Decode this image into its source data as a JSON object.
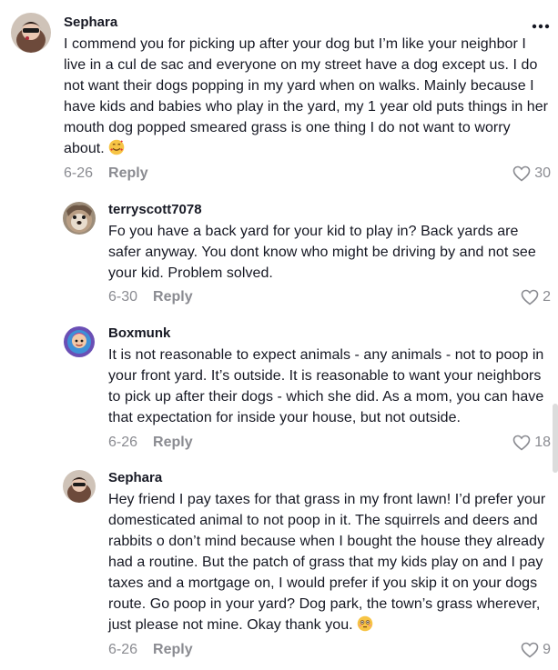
{
  "comments": [
    {
      "username": "Sephara",
      "text": "I commend you for picking up after your dog but I’m like your neighbor I live in a cul de sac and everyone on my street have a dog except us. I do not want their dogs popping in my yard when on walks. Mainly because I have kids and babies who play in the yard, my 1 year old puts things in her mouth dog popped smeared grass is one thing I do not want to worry about.",
      "emoji": "smiling-face-with-hearts",
      "date": "6-26",
      "reply_label": "Reply",
      "likes": "30"
    },
    {
      "username": "terryscott7078",
      "text": "Fo you have a back yard for your kid to play in? Back yards are safer anyway. You dont know who might be driving by and not see your kid. Problem solved.",
      "date": "6-30",
      "reply_label": "Reply",
      "likes": "2"
    },
    {
      "username": "Boxmunk",
      "text": "It is not reasonable to expect animals - any animals - not to poop in your front yard. It’s outside. It is reasonable to want your neighbors to pick up after their dogs - which she did. As a mom, you can have that expectation for inside your house, but not outside.",
      "date": "6-26",
      "reply_label": "Reply",
      "likes": "18"
    },
    {
      "username": "Sephara",
      "text": "Hey friend I pay taxes for that grass in my front lawn! I’d prefer your domesticated animal to not poop in it. The squirrels and deers and rabbits o don’t mind because when I bought the house they already had a routine. But the patch of grass that my kids play on and I pay taxes and a mortgage on, I would prefer if you skip it on your dogs route. Go poop in your yard? Dog park, the town’s grass wherever, just please not mine. Okay thank you.",
      "emoji": "flushed-face",
      "date": "6-26",
      "reply_label": "Reply",
      "likes": "9"
    }
  ],
  "icons": {
    "more": "more-options-icon",
    "like": "heart-icon"
  },
  "colors": {
    "text": "#161823",
    "muted": "#8a8b91"
  }
}
